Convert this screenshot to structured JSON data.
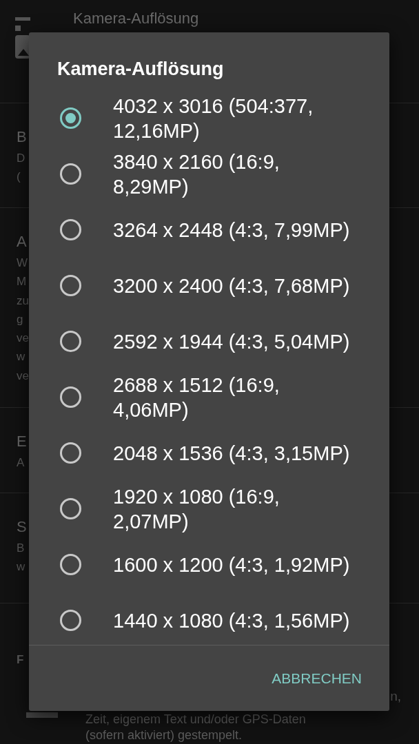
{
  "background": {
    "header_title": "Kamera-Auflösung",
    "rows": [
      {
        "title": "B",
        "lines": [
          "D",
          "("
        ]
      },
      {
        "title": "A",
        "lines": [
          "W",
          "M",
          "zu",
          "g",
          "ve",
          "w",
          "ve"
        ]
      },
      {
        "title": "E",
        "lines": [
          "A"
        ]
      },
      {
        "title": "S",
        "lines": [
          "B",
          "w"
        ]
      }
    ],
    "section": "F",
    "bottom_right": "n,",
    "bottom_lines": [
      "Zeit, eigenem Text und/oder GPS-Daten",
      "(sofern aktiviert) gestempelt."
    ]
  },
  "dialog": {
    "title": "Kamera-Auflösung",
    "options": [
      {
        "label": "4032 x 3016 (504:377, 12,16MP)",
        "selected": true
      },
      {
        "label": "3840 x 2160 (16:9, 8,29MP)",
        "selected": false
      },
      {
        "label": "3264 x 2448 (4:3, 7,99MP)",
        "selected": false
      },
      {
        "label": "3200 x 2400 (4:3, 7,68MP)",
        "selected": false
      },
      {
        "label": "2592 x 1944 (4:3, 5,04MP)",
        "selected": false
      },
      {
        "label": "2688 x 1512 (16:9, 4,06MP)",
        "selected": false
      },
      {
        "label": "2048 x 1536 (4:3, 3,15MP)",
        "selected": false
      },
      {
        "label": "1920 x 1080 (16:9, 2,07MP)",
        "selected": false
      },
      {
        "label": "1600 x 1200 (4:3, 1,92MP)",
        "selected": false
      },
      {
        "label": "1440 x 1080 (4:3, 1,56MP)",
        "selected": false
      }
    ],
    "button": "ABBRECHEN"
  }
}
